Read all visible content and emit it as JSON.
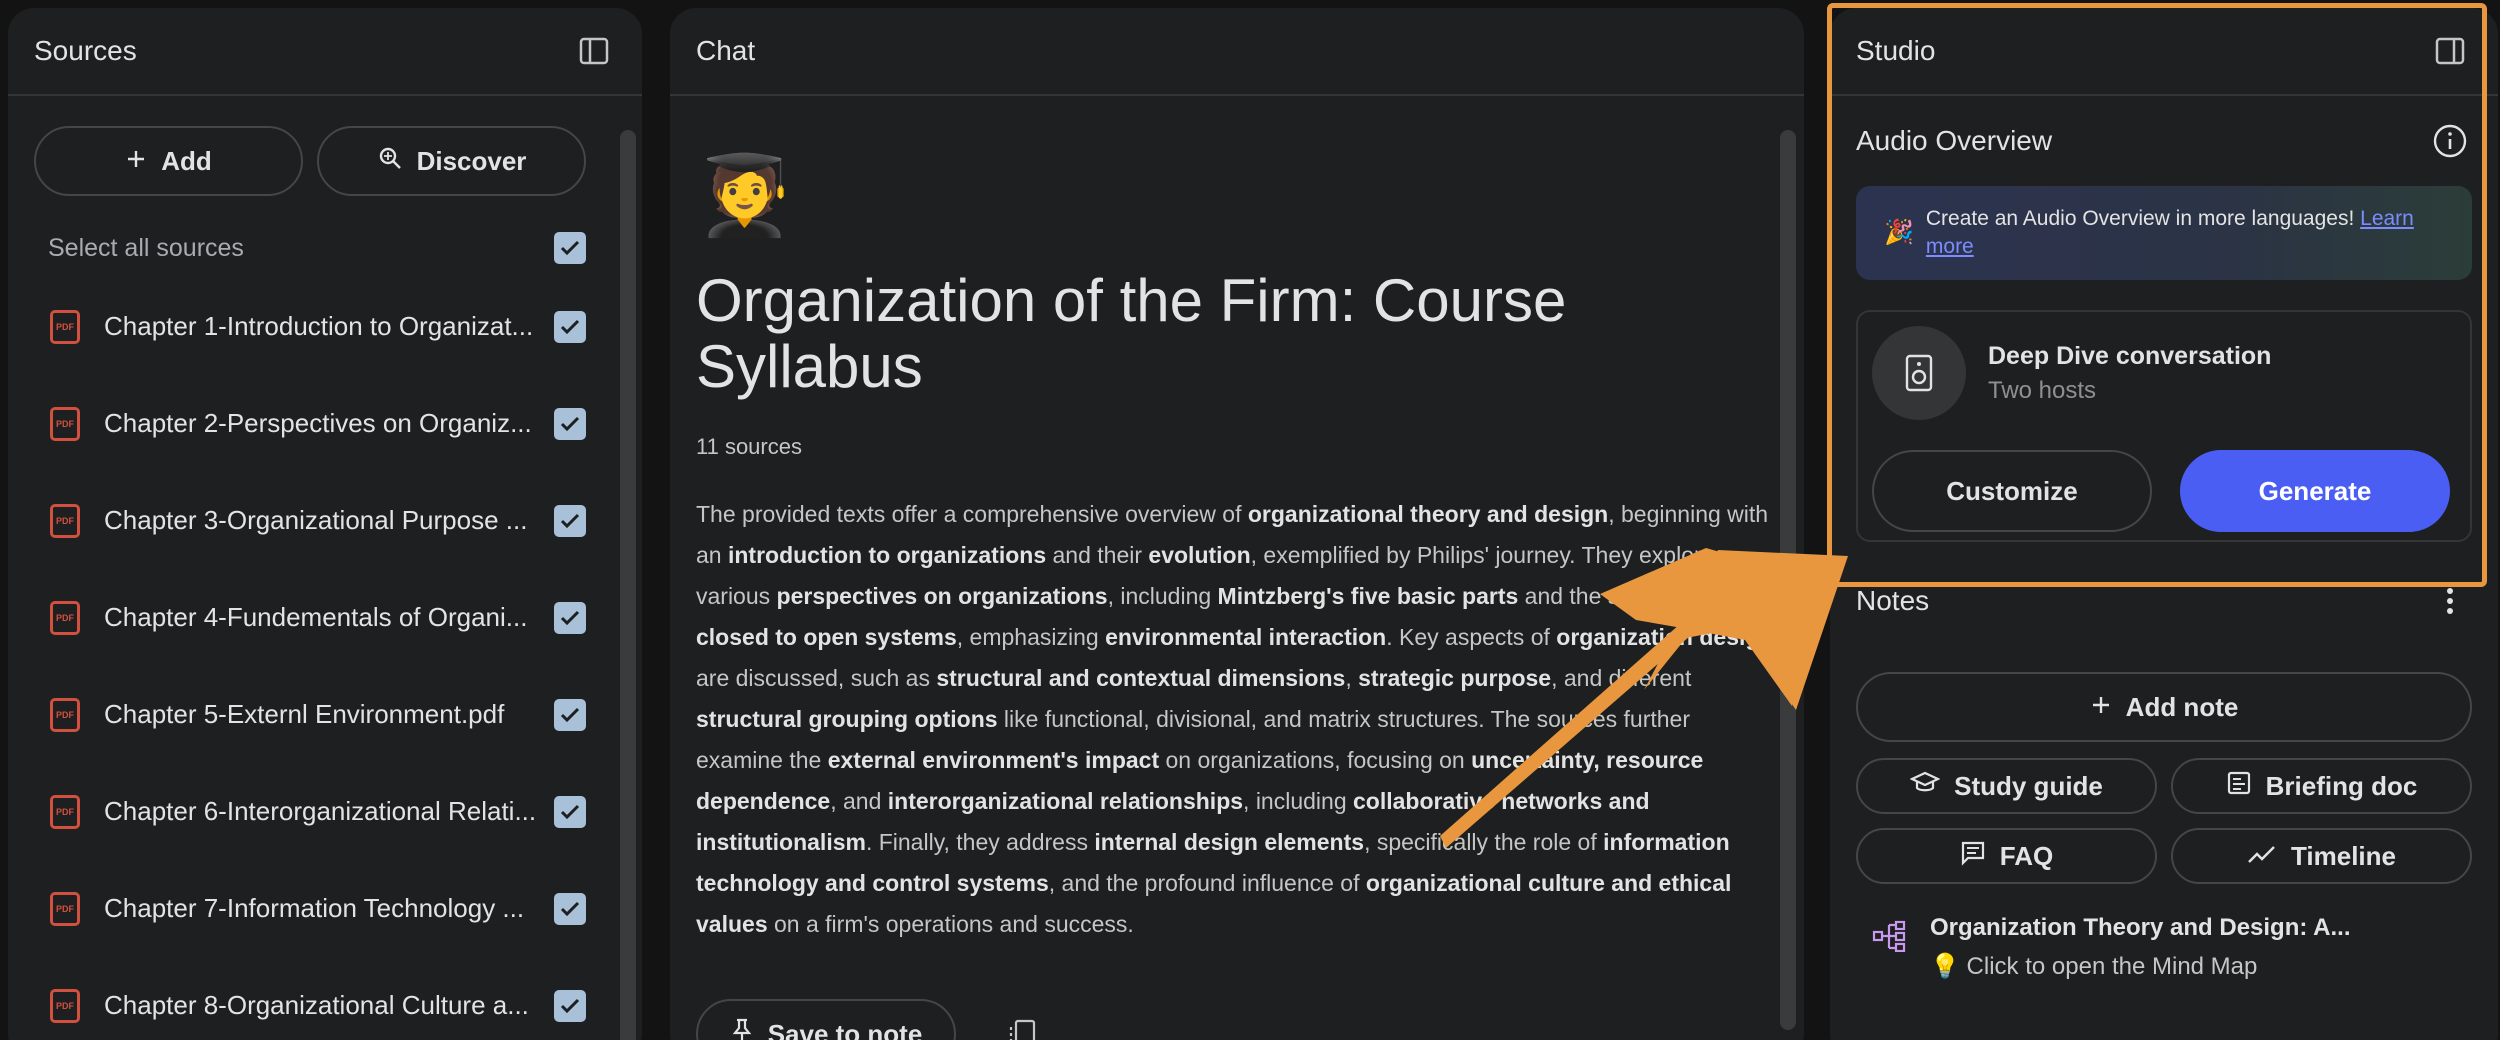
{
  "sources": {
    "title": "Sources",
    "add_label": "Add",
    "discover_label": "Discover",
    "select_all_label": "Select all sources",
    "items": [
      {
        "label": "Chapter 1-Introduction to Organizat..."
      },
      {
        "label": "Chapter 2-Perspectives on Organiz..."
      },
      {
        "label": "Chapter 3-Organizational Purpose ..."
      },
      {
        "label": "Chapter 4-Fundementals of Organi..."
      },
      {
        "label": "Chapter 5-Externl Environment.pdf"
      },
      {
        "label": "Chapter 6-Interorganizational Relati..."
      },
      {
        "label": "Chapter 7-Information Technology ..."
      },
      {
        "label": "Chapter 8-Organizational Culture a..."
      }
    ],
    "pdf_badge": "PDF"
  },
  "chat": {
    "title": "Chat",
    "emoji": "🧑‍🎓",
    "notebook_title": "Organization of the Firm: Course Syllabus",
    "source_count": "11 sources",
    "summary_parts": [
      {
        "t": "The provided texts offer a comprehensive overview of ",
        "b": false
      },
      {
        "t": "organizational theory and design",
        "b": true
      },
      {
        "t": ", beginning with an ",
        "b": false
      },
      {
        "t": "introduction to organizations",
        "b": true
      },
      {
        "t": " and their ",
        "b": false
      },
      {
        "t": "evolution",
        "b": true
      },
      {
        "t": ", exemplified by Philips' journey. They explore various ",
        "b": false
      },
      {
        "t": "perspectives on organizations",
        "b": true
      },
      {
        "t": ", including ",
        "b": false
      },
      {
        "t": "Mintzberg's five basic parts",
        "b": true
      },
      {
        "t": " and the shift from ",
        "b": false
      },
      {
        "t": "closed to open systems",
        "b": true
      },
      {
        "t": ", emphasizing ",
        "b": false
      },
      {
        "t": "environmental interaction",
        "b": true
      },
      {
        "t": ". Key aspects of ",
        "b": false
      },
      {
        "t": "organization design",
        "b": true
      },
      {
        "t": " are discussed, such as ",
        "b": false
      },
      {
        "t": "structural and contextual dimensions",
        "b": true
      },
      {
        "t": ", ",
        "b": false
      },
      {
        "t": "strategic purpose",
        "b": true
      },
      {
        "t": ", and different ",
        "b": false
      },
      {
        "t": "structural grouping options",
        "b": true
      },
      {
        "t": " like functional, divisional, and matrix structures. The sources further examine the ",
        "b": false
      },
      {
        "t": "external environment's impact",
        "b": true
      },
      {
        "t": " on organizations, focusing on ",
        "b": false
      },
      {
        "t": "uncertainty, resource dependence",
        "b": true
      },
      {
        "t": ", and ",
        "b": false
      },
      {
        "t": "interorganizational relationships",
        "b": true
      },
      {
        "t": ", including ",
        "b": false
      },
      {
        "t": "collaborative networks and institutionalism",
        "b": true
      },
      {
        "t": ". Finally, they address ",
        "b": false
      },
      {
        "t": "internal design elements",
        "b": true
      },
      {
        "t": ", specifically the role of ",
        "b": false
      },
      {
        "t": "information technology and control systems",
        "b": true
      },
      {
        "t": ", and the profound influence of ",
        "b": false
      },
      {
        "t": "organizational culture and ethical values",
        "b": true
      },
      {
        "t": " on a firm's operations and success.",
        "b": false
      }
    ],
    "save_to_note_label": "Save to note"
  },
  "studio": {
    "title": "Studio",
    "audio_overview_label": "Audio Overview",
    "banner_text": "Create an Audio Overview in more languages! ",
    "banner_link": "Learn more",
    "deep_dive_title": "Deep Dive conversation",
    "deep_dive_sub": "Two hosts",
    "customize_label": "Customize",
    "generate_label": "Generate",
    "notes_label": "Notes",
    "add_note_label": "Add note",
    "study_guide_label": "Study guide",
    "briefing_doc_label": "Briefing doc",
    "faq_label": "FAQ",
    "timeline_label": "Timeline",
    "mind_map_title": "Organization Theory and Design: A...",
    "mind_map_sub": "💡 Click to open the Mind Map"
  },
  "colors": {
    "highlight": "#e8973e",
    "generate": "#4a5ef4",
    "pdf": "#d1503f",
    "link": "#7c8cff"
  }
}
